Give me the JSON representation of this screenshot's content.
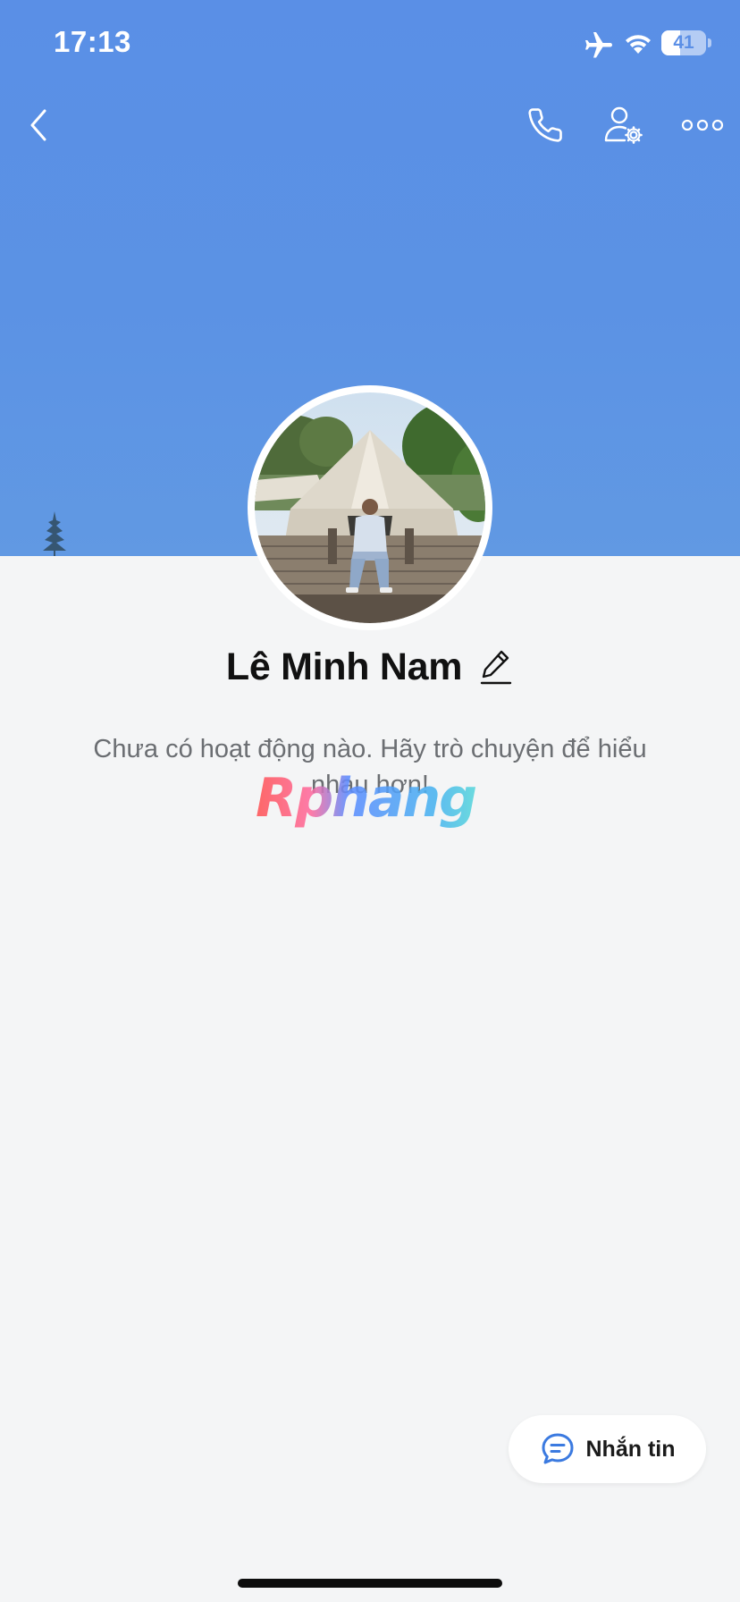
{
  "status_bar": {
    "time": "17:13",
    "battery_percent": "41",
    "battery_level": 0.41,
    "airplane_mode": true,
    "wifi": true
  },
  "top_bar": {
    "icons": [
      "chevron-left-icon",
      "phone-icon",
      "user-settings-icon",
      "more-icon"
    ]
  },
  "profile": {
    "name": "Lê Minh Nam",
    "empty_message": "Chưa có hoạt động nào. Hãy trò chuyện để hiểu nhau hơn!"
  },
  "watermark": {
    "text": "Rphang"
  },
  "message_button": {
    "label": "Nhắn tin",
    "icon": "chat-bubble-icon"
  },
  "colors": {
    "cover": "#5b8fe6",
    "background": "#f4f5f6",
    "accent": "#3b7ae0",
    "text": "#111111",
    "muted_text": "#6b6e72"
  }
}
